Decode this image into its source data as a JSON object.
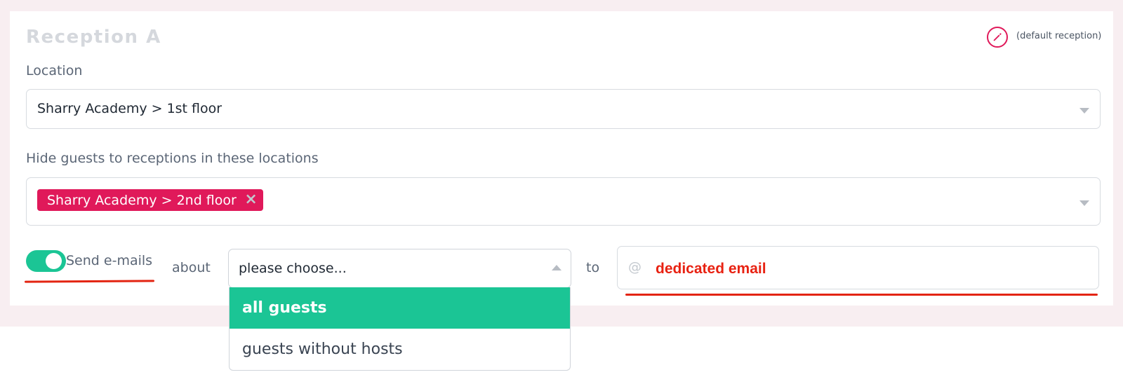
{
  "reception": {
    "title": "Reception A",
    "default_note": "(default reception)",
    "edit_icon": "pencil-icon"
  },
  "location": {
    "label": "Location",
    "value": "Sharry Academy > 1st floor"
  },
  "hide": {
    "label": "Hide guests to receptions in these locations",
    "tags": [
      "Sharry Academy > 2nd floor"
    ],
    "remove_glyph": "×"
  },
  "emails": {
    "enabled": true,
    "label": "Send e-mails",
    "about_label": "about",
    "to_label": "to",
    "select_value": "please choose...",
    "options": [
      "all guests",
      "guests without hosts"
    ],
    "highlighted_option": "all guests",
    "at_symbol": "@",
    "email_value": "dedicated email"
  },
  "colors": {
    "accent": "#e0195a",
    "toggle_on": "#1bc595",
    "annotation_red": "#e32411"
  }
}
